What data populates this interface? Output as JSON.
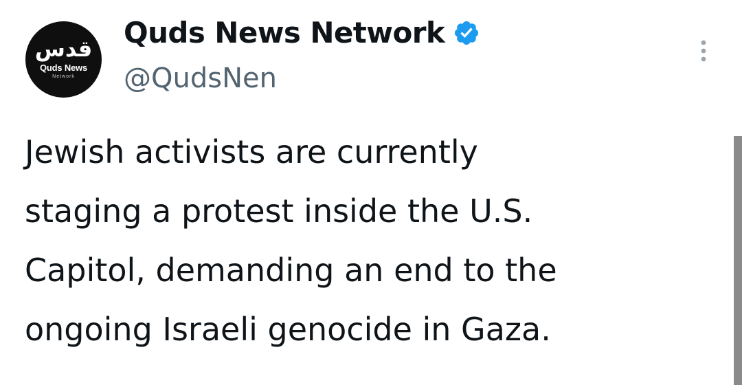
{
  "profile": {
    "display_name": "Quds News Network",
    "handle": "@QudsNen",
    "verified": true,
    "verified_icon": "verified-badge-icon",
    "verified_color": "#1d9bf0",
    "avatar": {
      "arabic": "قدس",
      "name": "Quds News",
      "sub": "Network"
    }
  },
  "menu": {
    "icon": "more-vertical-icon"
  },
  "tweet": {
    "lines": [
      "Jewish activists are currently",
      "staging a protest inside the U.S.",
      "Capitol, demanding an end to the",
      "ongoing Israeli genocide in Gaza."
    ]
  },
  "colors": {
    "text": "#0f1419",
    "muted": "#536471",
    "accent": "#1d9bf0",
    "scrollbar": "#8a8a8a"
  }
}
